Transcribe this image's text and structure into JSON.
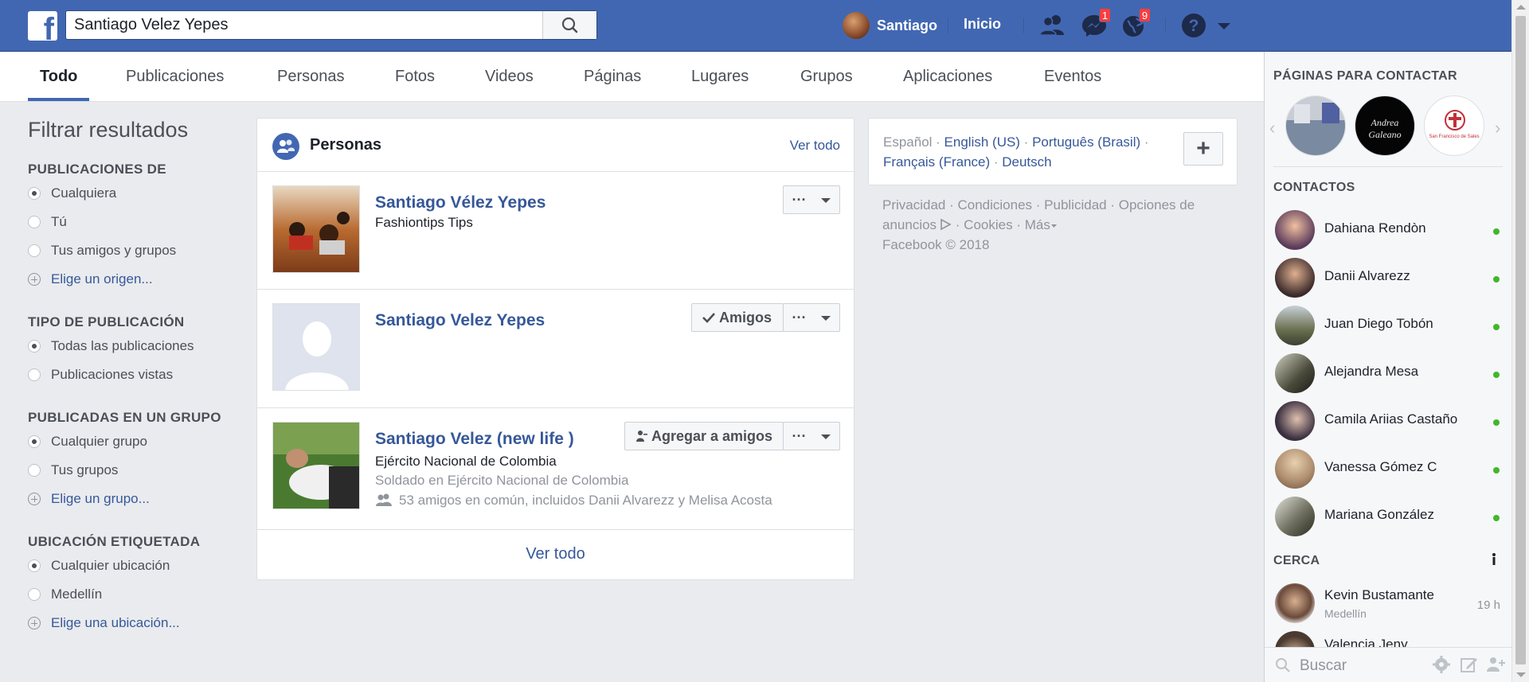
{
  "topbar": {
    "search_value": "Santiago Velez Yepes",
    "user_name": "Santiago",
    "home_label": "Inicio",
    "messages_badge": "1",
    "notifications_badge": "9"
  },
  "tabs": [
    {
      "label": "Todo"
    },
    {
      "label": "Publicaciones"
    },
    {
      "label": "Personas"
    },
    {
      "label": "Fotos"
    },
    {
      "label": "Videos"
    },
    {
      "label": "Páginas"
    },
    {
      "label": "Lugares"
    },
    {
      "label": "Grupos"
    },
    {
      "label": "Aplicaciones"
    },
    {
      "label": "Eventos"
    }
  ],
  "filters": {
    "title": "Filtrar resultados",
    "groups": [
      {
        "title": "PUBLICACIONES DE",
        "options": [
          "Cualquiera",
          "Tú",
          "Tus amigos y grupos"
        ],
        "add": "Elige un origen..."
      },
      {
        "title": "TIPO DE PUBLICACIÓN",
        "options": [
          "Todas las publicaciones",
          "Publicaciones vistas"
        ]
      },
      {
        "title": "PUBLICADAS EN UN GRUPO",
        "options": [
          "Cualquier grupo",
          "Tus grupos"
        ],
        "add": "Elige un grupo..."
      },
      {
        "title": "UBICACIÓN ETIQUETADA",
        "options": [
          "Cualquier ubicación",
          "Medellín"
        ],
        "add": "Elige una ubicación..."
      }
    ]
  },
  "results": {
    "title": "Personas",
    "see_all_top": "Ver todo",
    "people": [
      {
        "name": "Santiago Vélez Yepes",
        "line1": "Fashiontips Tips"
      },
      {
        "name": "Santiago Velez Yepes",
        "action": "Amigos"
      },
      {
        "name": "Santiago Velez (new life )",
        "line1": "Ejército Nacional de Colombia",
        "line2": "Soldado en Ejército Nacional de Colombia",
        "line3": "53 amigos en común, incluidos Danii Alvarezz y Melisa Acosta",
        "action": "Agregar a amigos"
      }
    ],
    "more_btn": "···",
    "see_all_bottom": "Ver todo"
  },
  "languages": {
    "current": "Español",
    "others": [
      "English (US)",
      "Português (Brasil)",
      "Français (France)",
      "Deutsch"
    ]
  },
  "footer": {
    "links": [
      "Privacidad",
      "Condiciones",
      "Publicidad",
      "Opciones de anuncios",
      "Cookies",
      "Más"
    ],
    "copyright": "Facebook © 2018"
  },
  "sidebar": {
    "pages_title": "PÁGINAS PARA CONTACTAR",
    "pages": [
      {
        "caption": ""
      },
      {
        "caption": "Andrea Galeano"
      },
      {
        "caption": "San Francisco de Sales"
      }
    ],
    "contacts_title": "CONTACTOS",
    "contacts": [
      {
        "name": "Dahiana Rendòn",
        "color": "#5a3a5a"
      },
      {
        "name": "Danii Alvarezz",
        "color": "#3a2a2a"
      },
      {
        "name": "Juan Diego Tobón",
        "color": "#6a7050"
      },
      {
        "name": "Alejandra Mesa",
        "color": "#4a4a3a"
      },
      {
        "name": "Camila Ariias Castaño",
        "color": "#3a3040"
      },
      {
        "name": "Vanessa Gómez C",
        "color": "#b09070"
      },
      {
        "name": "Mariana González",
        "color": "#707060"
      }
    ],
    "nearby_title": "CERCA",
    "nearby": [
      {
        "name": "Kevin Bustamante",
        "location": "Medellín",
        "time": "19 h"
      },
      {
        "name": "Valencia Jeny"
      }
    ],
    "search_placeholder": "Buscar"
  },
  "colors": {
    "brand": "#4267b2",
    "link": "#365899",
    "online": "#42b72a",
    "badge": "#fa3e3e"
  }
}
